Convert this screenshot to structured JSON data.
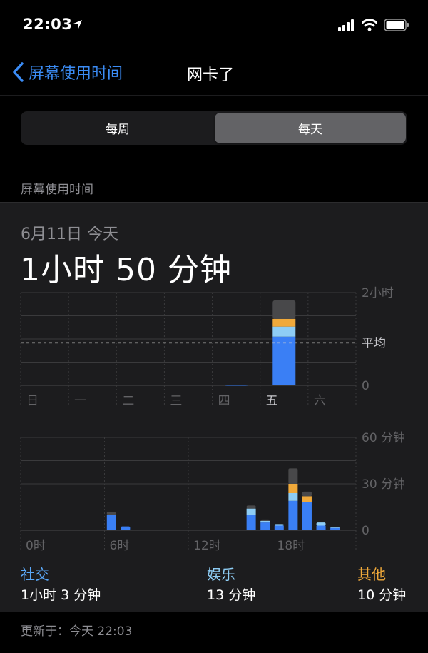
{
  "status": {
    "time": "22:03"
  },
  "nav": {
    "back_label": "屏幕使用时间",
    "title": "网卡了"
  },
  "segment": {
    "week": "每周",
    "day": "每天"
  },
  "section_label": "屏幕使用时间",
  "summary": {
    "date": "6月11日 今天",
    "total": "1小时 50 分钟"
  },
  "colors": {
    "social": "#3a7ff5",
    "entertainment": "#8ecdf5",
    "other": "#f0a93a",
    "misc": "#48484a",
    "accent": "#3b8cf5"
  },
  "chart_data": [
    {
      "type": "bar",
      "categories": [
        "日",
        "一",
        "二",
        "三",
        "四",
        "五",
        "六"
      ],
      "y_ticks": [
        "2小时",
        "平均",
        "0"
      ],
      "ylim": [
        0,
        120
      ],
      "average": 55,
      "series": [
        {
          "name": "社交",
          "values": [
            0,
            0,
            0,
            0,
            0.5,
            63,
            0
          ]
        },
        {
          "name": "娱乐",
          "values": [
            0,
            0,
            0,
            0,
            0,
            13,
            0
          ]
        },
        {
          "name": "其他",
          "values": [
            0,
            0,
            0,
            0,
            0,
            10,
            0
          ]
        },
        {
          "values": [
            0,
            0,
            0,
            0,
            0,
            24,
            0
          ]
        }
      ],
      "grid": true
    },
    {
      "type": "bar",
      "x_ticks": [
        "0时",
        "6时",
        "12时",
        "18时"
      ],
      "y_ticks": [
        "60 分钟",
        "30 分钟",
        "0"
      ],
      "ylim": [
        0,
        60
      ],
      "hours": [
        6,
        7,
        16,
        17,
        18,
        19,
        20,
        21,
        22
      ],
      "series": [
        {
          "name": "社交",
          "values": [
            10,
            2.5,
            10,
            5,
            3,
            19,
            18,
            3,
            1.5
          ]
        },
        {
          "name": "娱乐",
          "values": [
            0,
            0,
            4,
            1,
            1,
            5,
            0,
            2,
            0.5
          ]
        },
        {
          "name": "其他",
          "values": [
            0,
            0,
            0,
            0,
            0,
            6,
            4,
            0,
            0
          ]
        },
        {
          "values": [
            2,
            0,
            2,
            1,
            0,
            10,
            3,
            0,
            0
          ]
        }
      ],
      "grid": true
    }
  ],
  "legend": [
    {
      "label": "社交",
      "value": "1小时 3 分钟",
      "color": "#5aa8f8"
    },
    {
      "label": "娱乐",
      "value": "13 分钟",
      "color": "#8ecdf5"
    },
    {
      "label": "其他",
      "value": "10 分钟",
      "color": "#f0a93a"
    }
  ],
  "updated": "更新于：今天 22:03"
}
